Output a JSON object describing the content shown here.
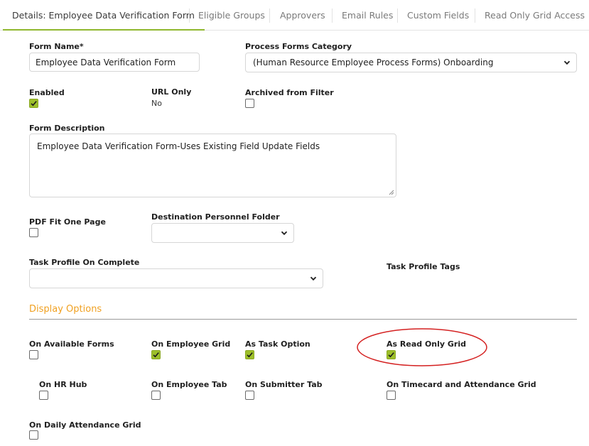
{
  "tabs": [
    {
      "label": "Details: Employee Data Verification Form",
      "active": true
    },
    {
      "label": "Eligible Groups"
    },
    {
      "label": "Approvers"
    },
    {
      "label": "Email Rules"
    },
    {
      "label": "Custom Fields"
    },
    {
      "label": "Read Only Grid Access"
    }
  ],
  "form": {
    "form_name_label": "Form Name*",
    "form_name_value": "Employee Data Verification Form",
    "category_label": "Process Forms Category",
    "category_value": "(Human Resource Employee Process Forms) Onboarding",
    "enabled_label": "Enabled",
    "enabled_checked": true,
    "url_only_label": "URL Only",
    "url_only_value": "No",
    "archived_label": "Archived from Filter",
    "archived_checked": false,
    "description_label": "Form Description",
    "description_value": "Employee Data Verification Form-Uses Existing Field Update Fields",
    "pdf_fit_label": "PDF Fit One Page",
    "pdf_fit_checked": false,
    "destination_label": "Destination Personnel Folder",
    "destination_value": "",
    "task_profile_label": "Task Profile On Complete",
    "task_profile_value": "",
    "task_tags_label": "Task Profile Tags"
  },
  "display_options": {
    "title": "Display Options",
    "on_available_forms": {
      "label": "On Available Forms",
      "checked": false
    },
    "on_employee_grid": {
      "label": "On Employee Grid",
      "checked": true
    },
    "as_task_option": {
      "label": "As Task Option",
      "checked": true
    },
    "as_read_only_grid": {
      "label": "As Read Only Grid",
      "checked": true
    },
    "on_hr_hub": {
      "label": "On HR Hub",
      "checked": false
    },
    "on_employee_tab": {
      "label": "On Employee Tab",
      "checked": false
    },
    "on_submitter_tab": {
      "label": "On Submitter Tab",
      "checked": false
    },
    "on_timecard": {
      "label": "On Timecard and Attendance Grid",
      "checked": false
    },
    "on_daily_attendance": {
      "label": "On Daily Attendance Grid",
      "checked": false
    }
  },
  "colors": {
    "accent_green": "#9dbf2a",
    "section_orange": "#f0a020",
    "annotation_red": "#d42020"
  }
}
